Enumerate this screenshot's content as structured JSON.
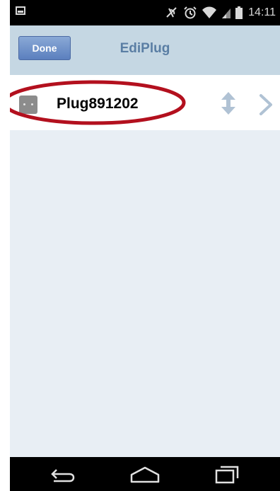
{
  "status_bar": {
    "time": "14:11",
    "icons": [
      "image-icon",
      "mute-icon",
      "alarm-icon",
      "wifi-icon",
      "signal-icon",
      "battery-icon"
    ]
  },
  "action_bar": {
    "done_label": "Done",
    "title": "EdiPlug"
  },
  "devices": [
    {
      "name": "Plug891202",
      "icon": "plug-icon",
      "actions": [
        "reorder-icon",
        "chevron-right-icon"
      ]
    }
  ],
  "annotation": {
    "highlight_color": "#b3101e"
  },
  "nav_bar": {
    "buttons": [
      "back-icon",
      "home-icon",
      "recent-apps-icon"
    ]
  },
  "colors": {
    "action_bar_bg": "#c5d7e3",
    "title_color": "#5a7ea4",
    "done_button": "#6b8cc8",
    "list_bg": "#e8eef4",
    "row_icon": "#b0c2d4"
  }
}
